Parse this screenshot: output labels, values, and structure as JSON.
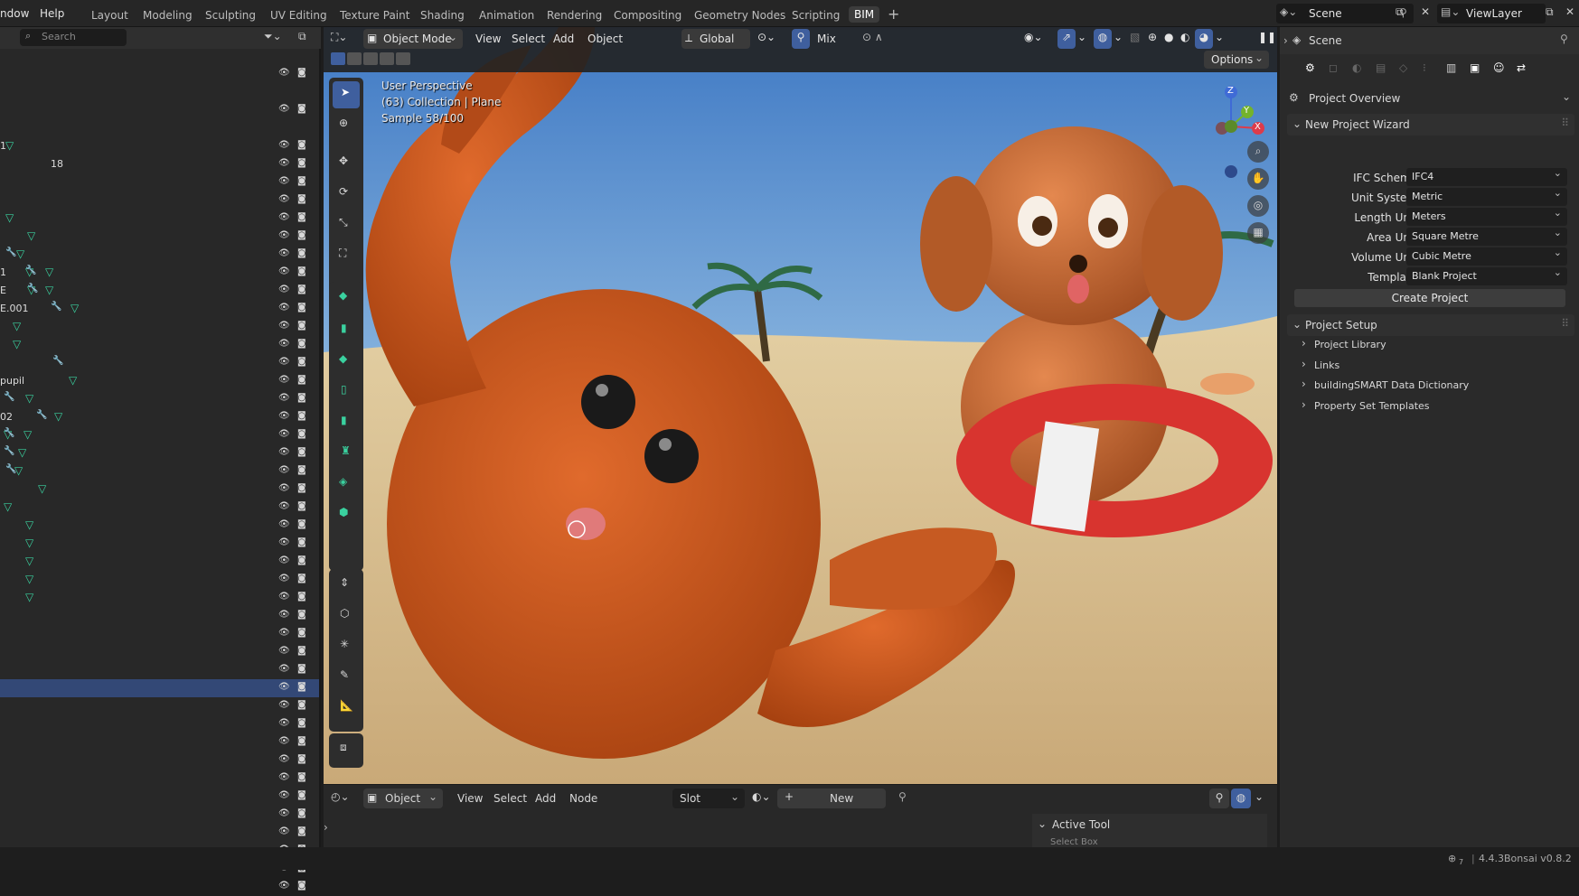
{
  "menu": {
    "window": "ndow",
    "help": "Help"
  },
  "workspaces": [
    "Layout",
    "Modeling",
    "Sculpting",
    "UV Editing",
    "Texture Paint",
    "Shading",
    "Animation",
    "Rendering",
    "Compositing",
    "Geometry Nodes",
    "Scripting",
    "BIM"
  ],
  "scene": {
    "label": "Scene",
    "view_layer": "ViewLayer"
  },
  "outliner": {
    "search_placeholder": "Search",
    "row_labels": {
      "r4": "1",
      "r5": "18",
      "r11": "1",
      "r12": "E",
      "r13": "E.001",
      "r17": "pupil",
      "r19": "02"
    },
    "selected_row": 34
  },
  "viewport": {
    "mode": "Object Mode",
    "menus": [
      "View",
      "Select",
      "Add",
      "Object"
    ],
    "transform": "Global",
    "mix": "Mix",
    "options": "Options",
    "overlay_lines": [
      "User Perspective",
      "(63) Collection | Plane",
      "Sample 58/100"
    ],
    "gizmo": {
      "z": "Z",
      "y": "Y",
      "x": "X"
    }
  },
  "properties": {
    "header": "Scene",
    "context": "Project Overview",
    "wizard": {
      "title": "New Project Wizard",
      "rows": [
        {
          "label": "IFC Schema",
          "value": "IFC4"
        },
        {
          "label": "Unit System",
          "value": "Metric"
        },
        {
          "label": "Length Unit",
          "value": "Meters"
        },
        {
          "label": "Area Unit",
          "value": "Square Metre"
        },
        {
          "label": "Volume Unit",
          "value": "Cubic Metre"
        },
        {
          "label": "Template",
          "value": "Blank Project"
        }
      ],
      "create": "Create Project"
    },
    "setup": {
      "title": "Project Setup",
      "items": [
        "Project Library",
        "Links",
        "buildingSMART Data Dictionary",
        "Property Set Templates"
      ]
    }
  },
  "node_editor": {
    "type": "Object",
    "menus": [
      "View",
      "Select",
      "Add",
      "Node"
    ],
    "slot": "Slot",
    "new": "New",
    "active_tool": "Active Tool",
    "active_tool_item": "Select Box"
  },
  "status": {
    "version": "4.4.3",
    "addon": "Bonsai v0.8.2",
    "badge": "7"
  },
  "colors": {
    "accent": "#3f5f9e",
    "selected_row": "#334876",
    "mesh": "#3ad19f",
    "modifier": "#7b9cff"
  }
}
